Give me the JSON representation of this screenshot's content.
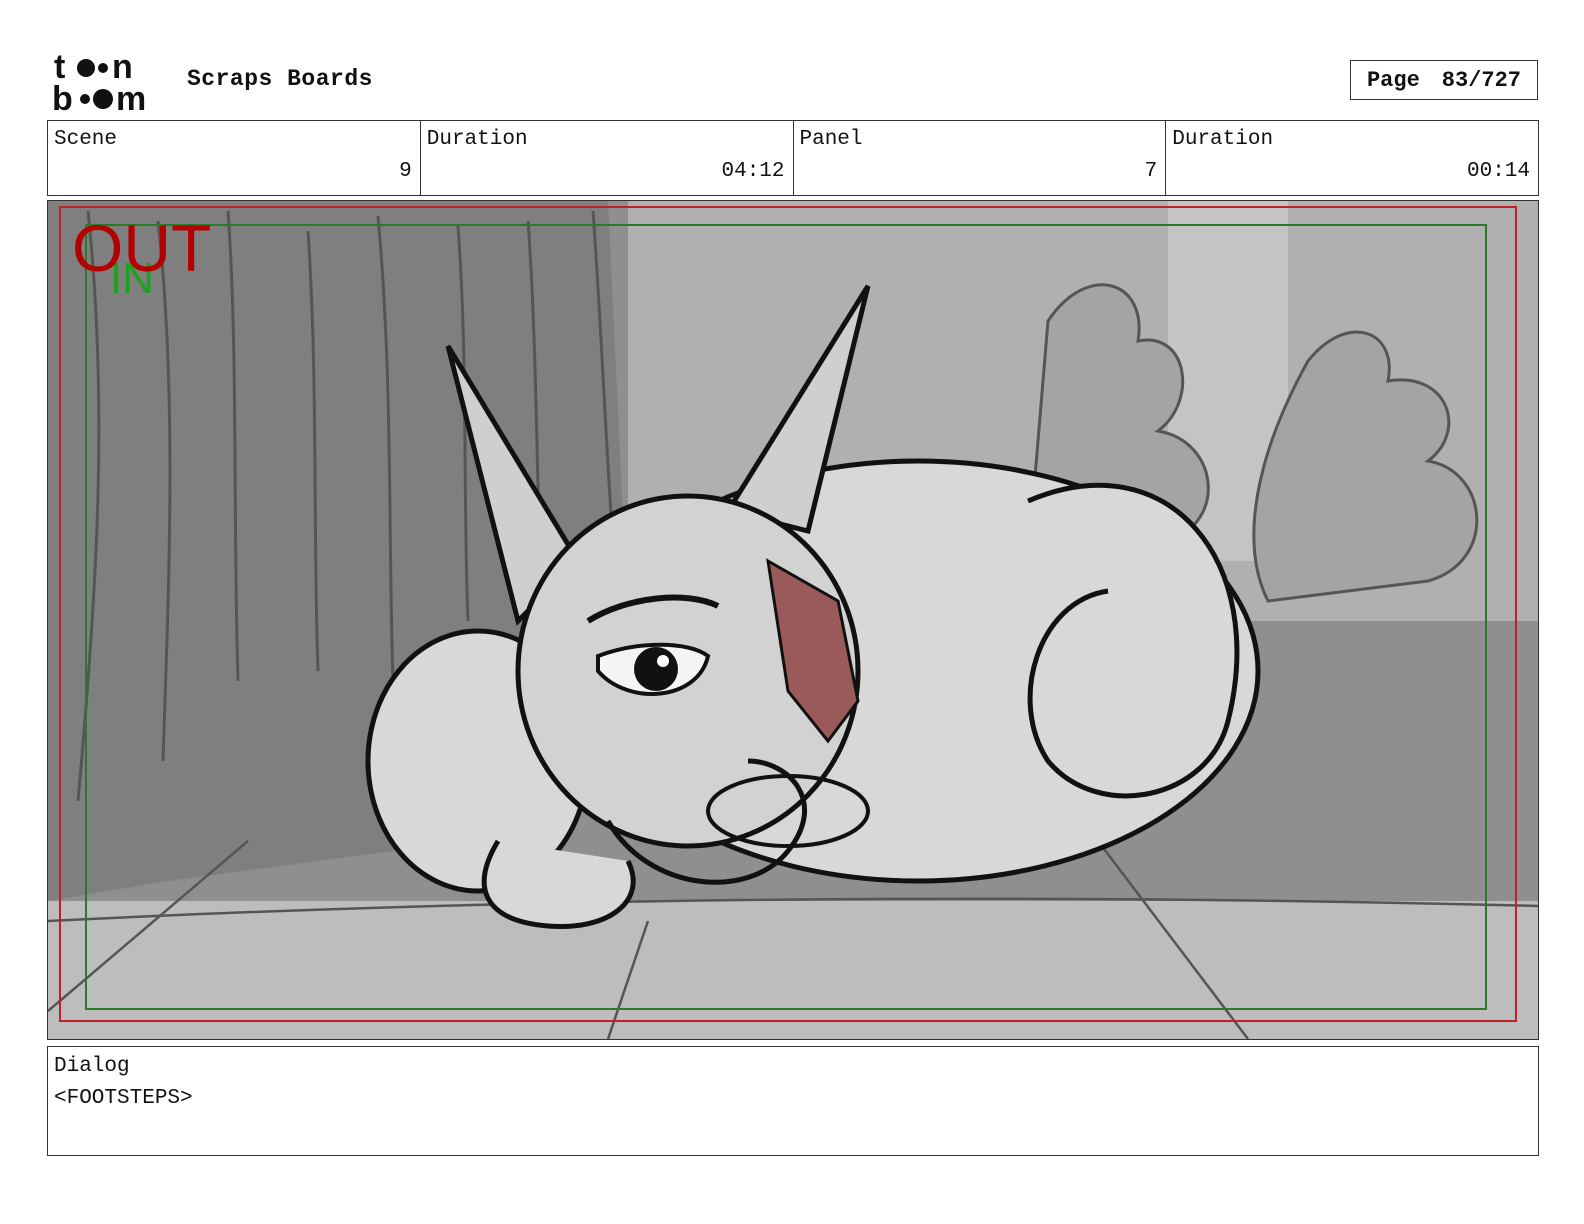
{
  "header": {
    "logo_text": "toon boom",
    "title": "Scraps Boards",
    "page_label": "Page",
    "page_value": "83/727"
  },
  "info": {
    "scene_label": "Scene",
    "scene_value": "9",
    "scene_duration_label": "Duration",
    "scene_duration_value": "04:12",
    "panel_label": "Panel",
    "panel_value": "7",
    "panel_duration_label": "Duration",
    "panel_duration_value": "00:14"
  },
  "panel": {
    "out_label": "OUT",
    "in_label": "IN",
    "out_color": "#b30000",
    "in_color": "#1aa31a",
    "frame_out_color": "#c0202a",
    "frame_in_color": "#2a7a2a"
  },
  "dialog": {
    "label": "Dialog",
    "text": "<FOOTSTEPS>"
  }
}
